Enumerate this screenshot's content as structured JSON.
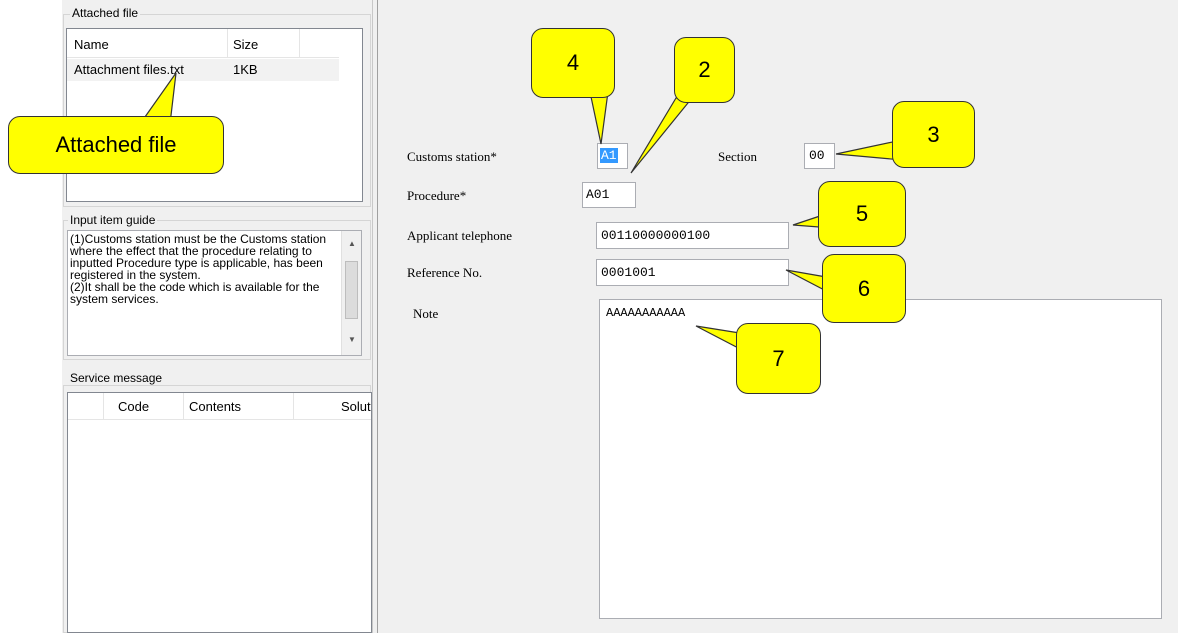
{
  "attached_file": {
    "group_title": "Attached file",
    "columns": [
      "Name",
      "Size"
    ],
    "rows": [
      {
        "name": "Attachment files.txt",
        "size": "1KB"
      }
    ]
  },
  "input_item_guide": {
    "group_title": "Input item guide",
    "text": "(1)Customs station must be the Customs station where the effect that the procedure relating to inputted Procedure type is applicable, has been registered in the system.\n(2)It shall be the code which is available for the system services."
  },
  "service_message": {
    "group_title": "Service message",
    "columns": [
      "Code",
      "Contents",
      "Solut"
    ]
  },
  "form": {
    "customs_station_label": "Customs station*",
    "customs_station_value": "A1",
    "section_label": "Section",
    "section_value": "00",
    "procedure_label": "Procedure*",
    "procedure_value": "A01",
    "telephone_label": "Applicant telephone",
    "telephone_value": "00110000000100",
    "reference_label": "Reference No.",
    "reference_value": "0001001",
    "note_label": "Note",
    "note_value": "AAAAAAAAAAA"
  },
  "callouts": {
    "attached_file": "Attached file",
    "c2": "2",
    "c3": "3",
    "c4": "4",
    "c5": "5",
    "c6": "6",
    "c7": "7"
  },
  "colors": {
    "callout_fill": "#ffff00",
    "selection": "#3399ff",
    "panel_bg": "#f0f0f0"
  }
}
